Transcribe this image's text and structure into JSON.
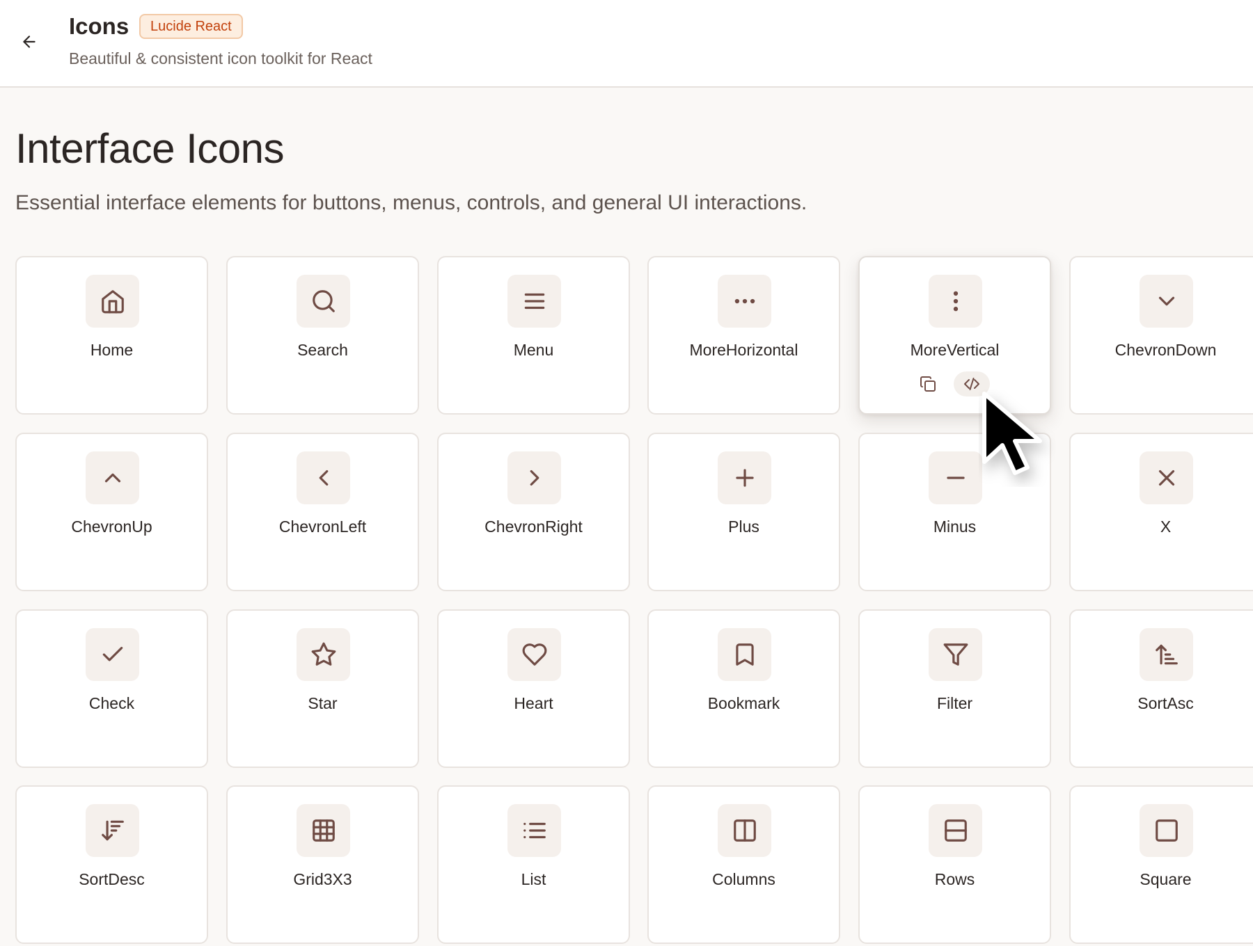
{
  "header": {
    "title": "Icons",
    "badge": "Lucide React",
    "subtitle": "Beautiful & consistent icon toolkit for React"
  },
  "section": {
    "title": "Interface Icons",
    "description": "Essential interface elements for buttons, menus, controls, and general UI interactions."
  },
  "icons": [
    {
      "label": "Home",
      "icon": "home-icon"
    },
    {
      "label": "Search",
      "icon": "search-icon"
    },
    {
      "label": "Menu",
      "icon": "menu-icon"
    },
    {
      "label": "MoreHorizontal",
      "icon": "more-horizontal-icon"
    },
    {
      "label": "MoreVertical",
      "icon": "more-vertical-icon",
      "hovered": true
    },
    {
      "label": "ChevronDown",
      "icon": "chevron-down-icon"
    },
    {
      "label": "ChevronUp",
      "icon": "chevron-up-icon"
    },
    {
      "label": "ChevronLeft",
      "icon": "chevron-left-icon"
    },
    {
      "label": "ChevronRight",
      "icon": "chevron-right-icon"
    },
    {
      "label": "Plus",
      "icon": "plus-icon"
    },
    {
      "label": "Minus",
      "icon": "minus-icon"
    },
    {
      "label": "X",
      "icon": "x-icon"
    },
    {
      "label": "Check",
      "icon": "check-icon"
    },
    {
      "label": "Star",
      "icon": "star-icon"
    },
    {
      "label": "Heart",
      "icon": "heart-icon"
    },
    {
      "label": "Bookmark",
      "icon": "bookmark-icon"
    },
    {
      "label": "Filter",
      "icon": "filter-icon"
    },
    {
      "label": "SortAsc",
      "icon": "sort-asc-icon"
    },
    {
      "label": "SortDesc",
      "icon": "sort-desc-icon"
    },
    {
      "label": "Grid3X3",
      "icon": "grid-3x3-icon"
    },
    {
      "label": "List",
      "icon": "list-icon"
    },
    {
      "label": "Columns",
      "icon": "columns-icon"
    },
    {
      "label": "Rows",
      "icon": "rows-icon"
    },
    {
      "label": "Square",
      "icon": "square-icon"
    }
  ],
  "hover_actions": [
    {
      "icon": "copy-icon"
    },
    {
      "icon": "code-icon"
    }
  ],
  "colors": {
    "accent": "#c2410c",
    "icon_stroke": "#6f4b44",
    "background": "#faf8f6"
  }
}
